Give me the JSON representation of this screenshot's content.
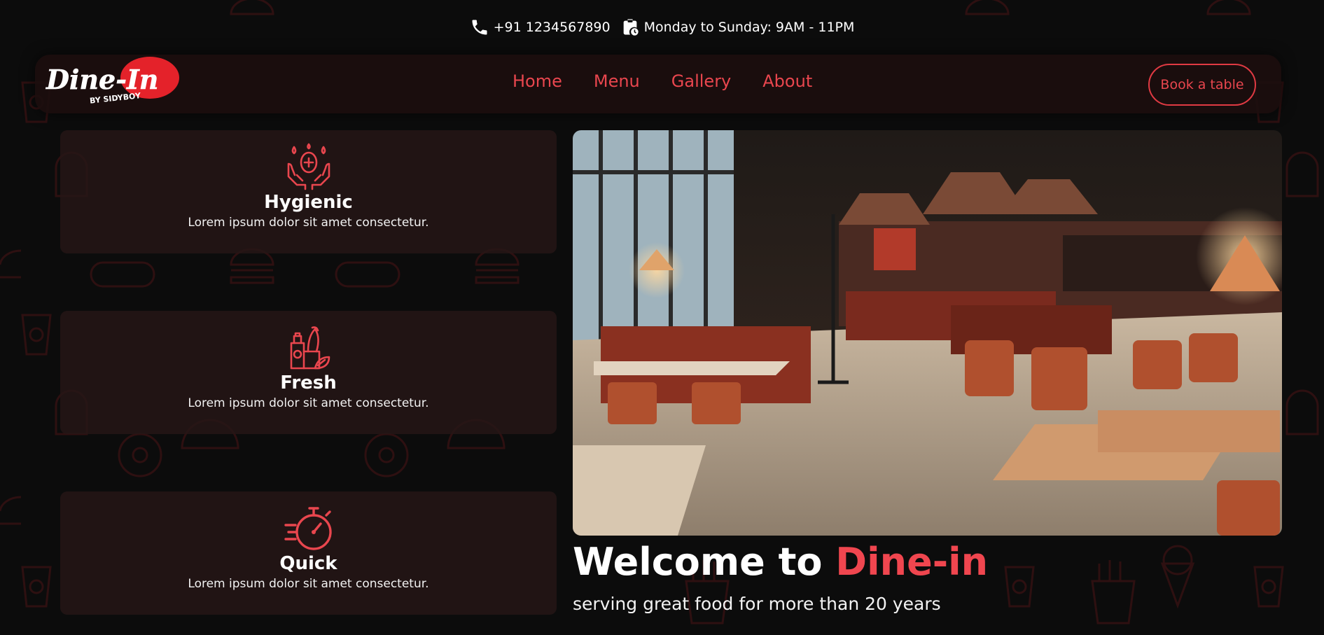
{
  "topbar": {
    "phone": "+91 1234567890",
    "hours": "Monday to Sunday: 9AM - 11PM"
  },
  "brand": {
    "logo_text": "Dine-In",
    "logo_subtext": "BY SIDYBOY"
  },
  "nav": {
    "items": [
      {
        "label": "Home"
      },
      {
        "label": "Menu"
      },
      {
        "label": "Gallery"
      },
      {
        "label": "About"
      }
    ],
    "cta_label": "Book a table"
  },
  "features": [
    {
      "title": "Hygienic",
      "text": "Lorem ipsum dolor sit amet consectetur.",
      "icon": "hygiene-hands-icon"
    },
    {
      "title": "Fresh",
      "text": "Lorem ipsum dolor sit amet consectetur.",
      "icon": "fresh-groceries-icon"
    },
    {
      "title": "Quick",
      "text": "Lorem ipsum dolor sit amet consectetur.",
      "icon": "stopwatch-icon"
    }
  ],
  "hero": {
    "welcome_prefix": "Welcome to ",
    "welcome_accent": "Dine-in",
    "tagline": "serving great food for more than 20 years"
  },
  "colors": {
    "accent": "#e9464e",
    "background": "#0c0c0c",
    "card": "#261616"
  }
}
